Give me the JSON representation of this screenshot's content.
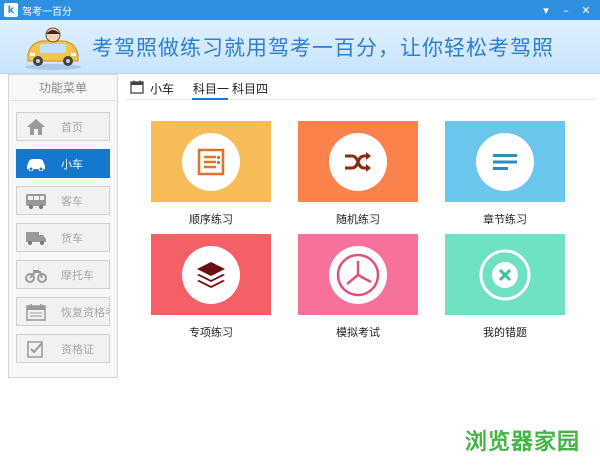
{
  "window": {
    "title": "驾考一百分",
    "app_icon_glyph": "k",
    "controls": [
      "▾",
      "–",
      "✕"
    ]
  },
  "banner": {
    "slogan": "考驾照做练习就用驾考一百分，让你轻松考驾照"
  },
  "sidebar": {
    "title": "功能菜单",
    "items": [
      {
        "label": "首页",
        "icon": "home-icon",
        "active": false
      },
      {
        "label": "小车",
        "icon": "car-icon",
        "active": true
      },
      {
        "label": "客车",
        "icon": "bus-icon",
        "active": false
      },
      {
        "label": "货车",
        "icon": "truck-icon",
        "active": false
      },
      {
        "label": "摩托车",
        "icon": "motorcycle-icon",
        "active": false
      },
      {
        "label": "恢复资格考",
        "icon": "calendar-icon",
        "active": false
      },
      {
        "label": "资格证",
        "icon": "certificate-icon",
        "active": false
      }
    ]
  },
  "tabbar": {
    "breadcrumb": "小车",
    "tabs": [
      {
        "label": "科目一",
        "active": true
      },
      {
        "label": "科目四",
        "active": false
      }
    ]
  },
  "tiles": [
    {
      "label": "顺序练习",
      "icon": "list-icon",
      "color": "#f7bc57",
      "icon_color": "#e0722b"
    },
    {
      "label": "随机练习",
      "icon": "shuffle-icon",
      "color": "#fb834b",
      "icon_color": "#8b2a0e"
    },
    {
      "label": "章节练习",
      "icon": "lines-icon",
      "color": "#6bc6ee",
      "icon_color": "#2f8bb4"
    },
    {
      "label": "专项练习",
      "icon": "layers-icon",
      "color": "#f56065",
      "icon_color": "#6b0f14"
    },
    {
      "label": "模拟考试",
      "icon": "clock-icon",
      "color": "#f6729a",
      "icon_color": "#e0507e"
    },
    {
      "label": "我的错题",
      "icon": "error-icon",
      "color": "#6ee0c4",
      "icon_color": "#3fbf9e"
    }
  ],
  "watermark": "浏览器家园"
}
